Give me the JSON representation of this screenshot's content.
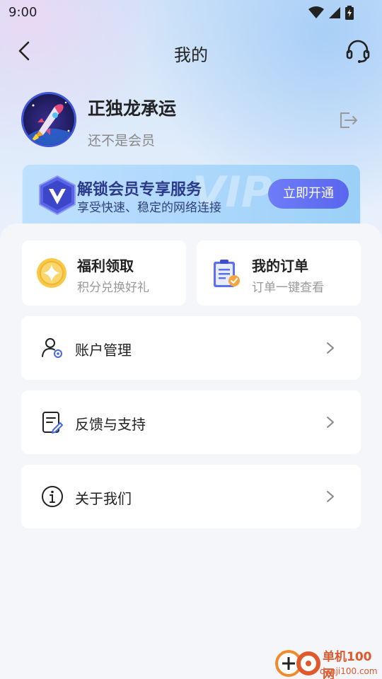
{
  "status_bar": {
    "time": "9:00"
  },
  "header": {
    "title": "我的"
  },
  "profile": {
    "name": "正独龙承运",
    "membership": "还不是会员"
  },
  "vip_banner": {
    "watermark": "VIP",
    "title": "解锁会员专享服务",
    "subtitle": "享受快速、稳定的网络连接",
    "button": "立即开通"
  },
  "quick_cards": [
    {
      "title": "福利领取",
      "subtitle": "积分兑换好礼",
      "icon": "coin-icon"
    },
    {
      "title": "我的订单",
      "subtitle": "订单一键查看",
      "icon": "order-clipboard-icon"
    }
  ],
  "menu": [
    {
      "label": "账户管理",
      "icon": "user-settings-icon"
    },
    {
      "label": "反馈与支持",
      "icon": "feedback-edit-icon"
    },
    {
      "label": "关于我们",
      "icon": "info-icon"
    }
  ],
  "watermark": {
    "name": "单机100网",
    "url": "danji100.com"
  },
  "colors": {
    "accent": "#5a66ee",
    "vip_title": "#2b3a8a",
    "muted": "#999999"
  }
}
